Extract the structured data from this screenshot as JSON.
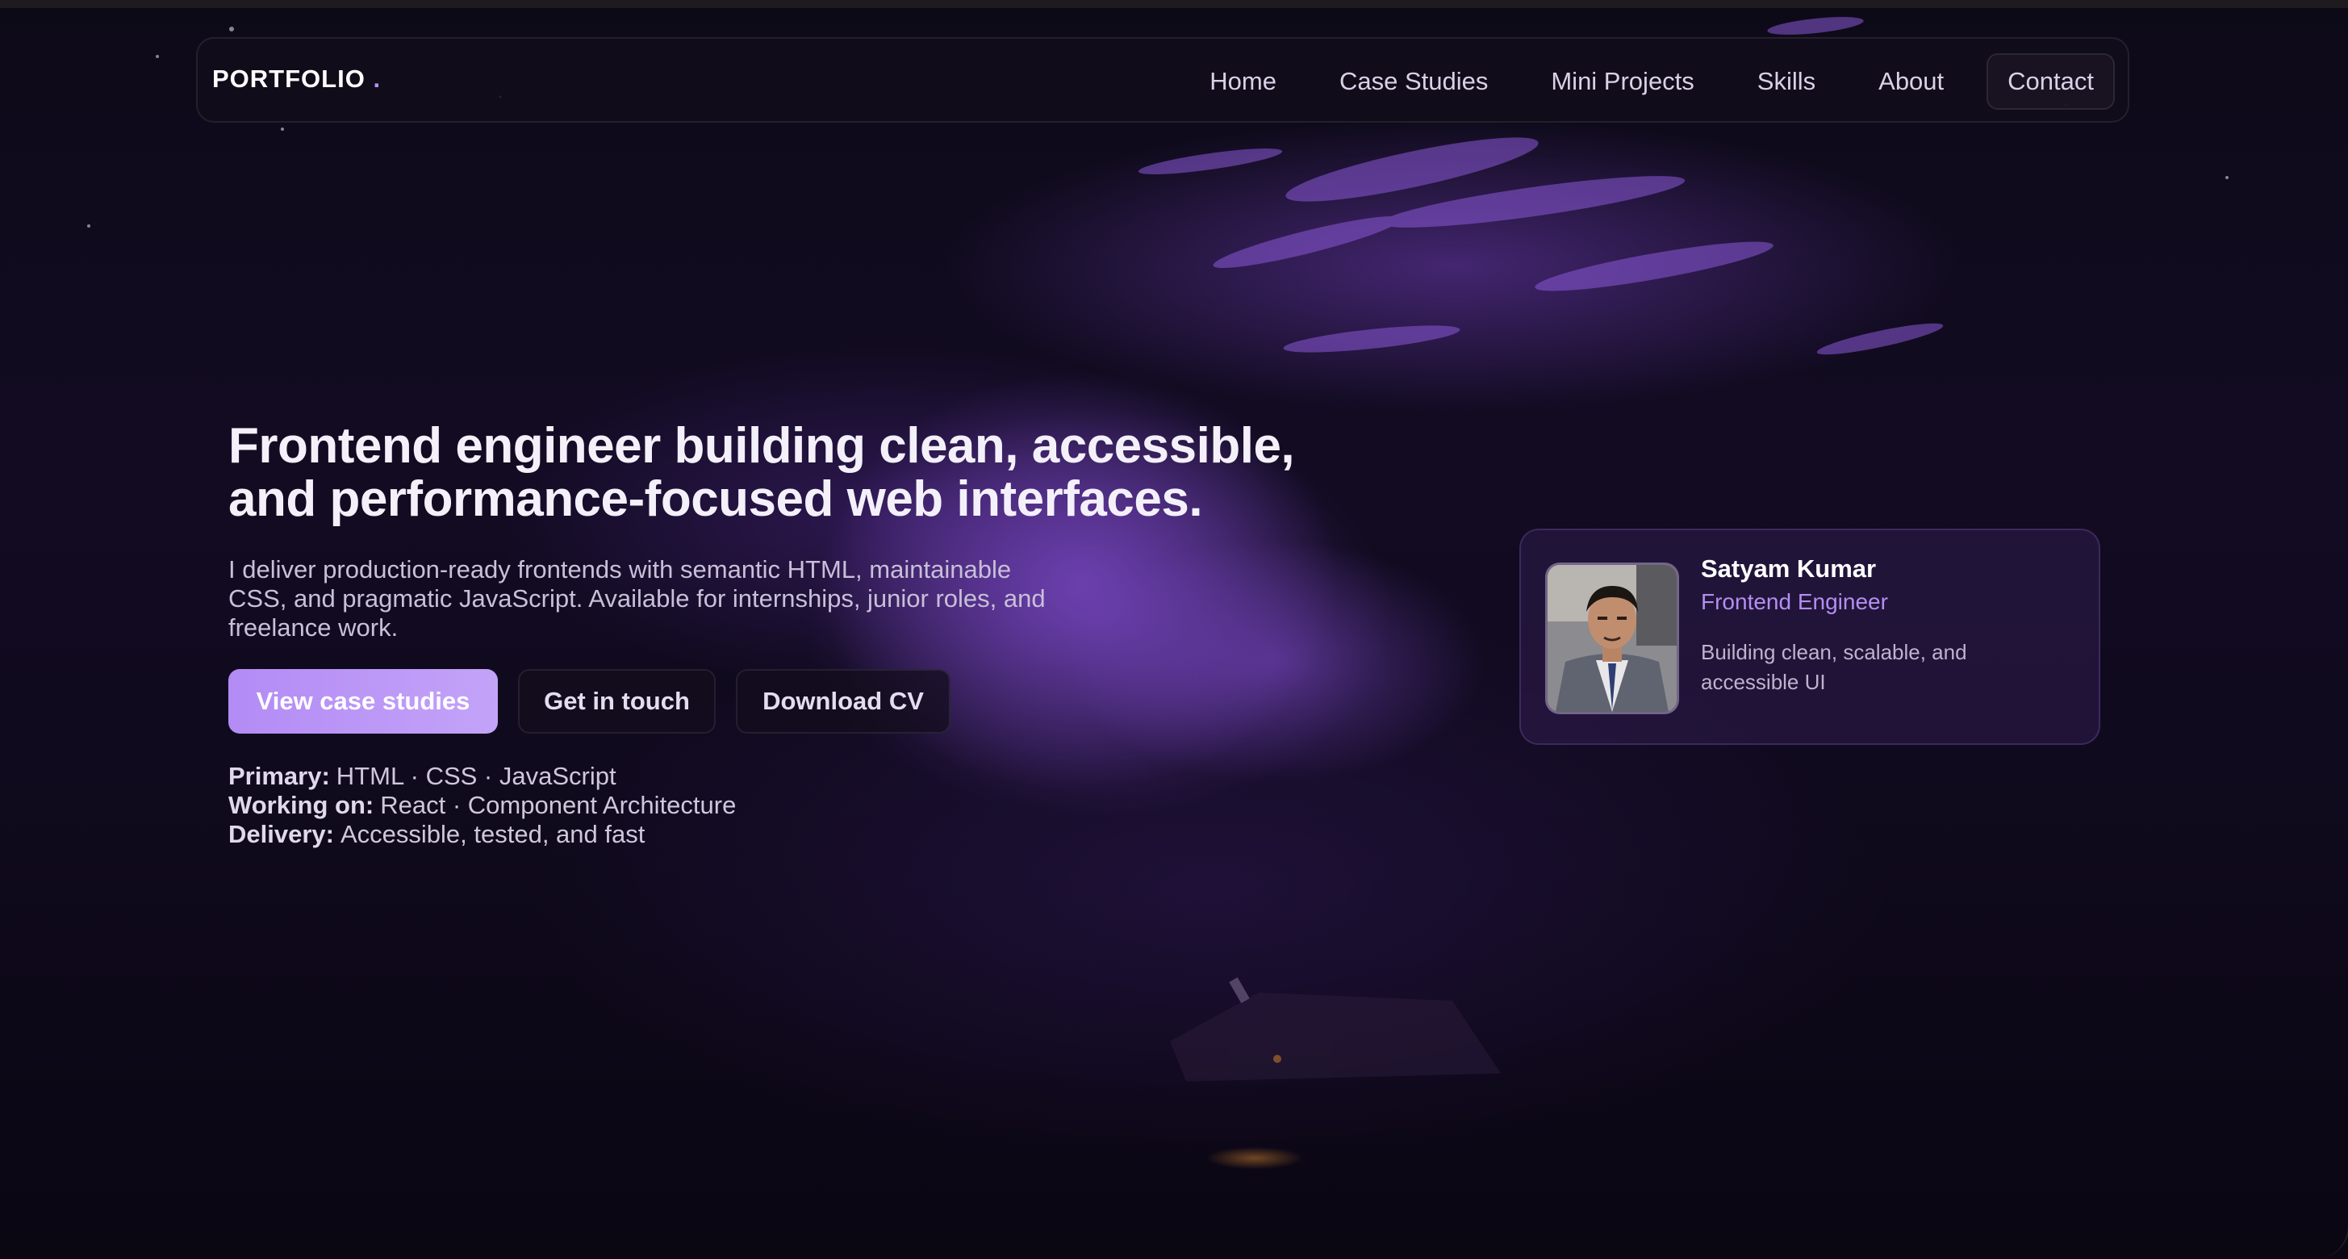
{
  "navbar": {
    "brand": "PORTFOLIO",
    "brand_dot": ".",
    "links": [
      {
        "label": "Home"
      },
      {
        "label": "Case Studies"
      },
      {
        "label": "Mini Projects"
      },
      {
        "label": "Skills"
      },
      {
        "label": "About"
      },
      {
        "label": "Contact"
      }
    ]
  },
  "hero": {
    "title_line_1": "Frontend engineer building clean, accessible,",
    "title_line_2": "and performance-focused web interfaces.",
    "description_line_1": "I deliver production-ready frontends with semantic HTML, maintainable",
    "description_line_2": "CSS, and pragmatic JavaScript. Available for internships, junior roles, and",
    "description_line_3": "freelance work.",
    "buttons": {
      "primary": "View case studies",
      "contact": "Get in touch",
      "cv": "Download CV"
    },
    "meta": [
      {
        "label": "Primary:",
        "value": "HTML · CSS · JavaScript"
      },
      {
        "label": "Working on:",
        "value": "React · Component Architecture"
      },
      {
        "label": "Delivery:",
        "value": "Accessible, tested, and fast"
      }
    ]
  },
  "profile": {
    "name": "Satyam Kumar",
    "role": "Frontend Engineer",
    "tagline_line_1": "Building clean, scalable, and",
    "tagline_line_2": "accessible UI"
  },
  "colors": {
    "accent": "#b892f7",
    "button_primary": "#b38bf5",
    "role_text": "#b48ef2",
    "background": "#0b0713"
  }
}
